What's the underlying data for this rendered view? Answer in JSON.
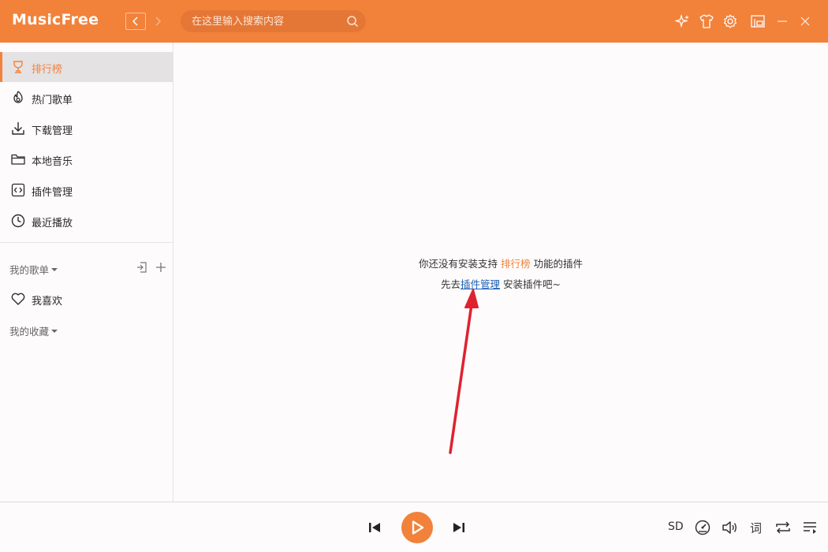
{
  "app": {
    "title": "MusicFree"
  },
  "header": {
    "search_placeholder": "在这里输入搜索内容",
    "icons": [
      "chevron-left-icon",
      "chevron-right-icon",
      "search-icon",
      "sparkle-icon",
      "shirt-icon",
      "gear-icon",
      "mini-mode-icon",
      "minimize-icon",
      "close-icon"
    ]
  },
  "sidebar": {
    "items": [
      {
        "label": "排行榜",
        "icon": "trophy-icon",
        "active": true
      },
      {
        "label": "热门歌单",
        "icon": "flame-icon",
        "active": false
      },
      {
        "label": "下载管理",
        "icon": "download-icon",
        "active": false
      },
      {
        "label": "本地音乐",
        "icon": "folder-icon",
        "active": false
      },
      {
        "label": "插件管理",
        "icon": "plugin-icon",
        "active": false
      },
      {
        "label": "最近播放",
        "icon": "clock-icon",
        "active": false
      }
    ],
    "my_playlists": {
      "title": "我的歌单",
      "items": [
        {
          "label": "我喜欢",
          "icon": "heart-icon"
        }
      ]
    },
    "my_collections": {
      "title": "我的收藏"
    }
  },
  "main": {
    "empty_prefix": "你还没有安装支持",
    "empty_highlight": "排行榜",
    "empty_suffix": "功能的插件",
    "hint_prefix": "先去",
    "hint_link": "插件管理",
    "hint_suffix": " 安装插件吧~"
  },
  "player": {
    "quality": "SD",
    "lyric_label": "词",
    "icons": [
      "skip-previous-icon",
      "play-icon",
      "skip-next-icon",
      "speed-icon",
      "volume-icon",
      "repeat-icon",
      "playlist-icon"
    ]
  },
  "colors": {
    "accent": "#f2813a",
    "link": "#1a5fb4",
    "annotation_arrow": "#e0212e"
  }
}
